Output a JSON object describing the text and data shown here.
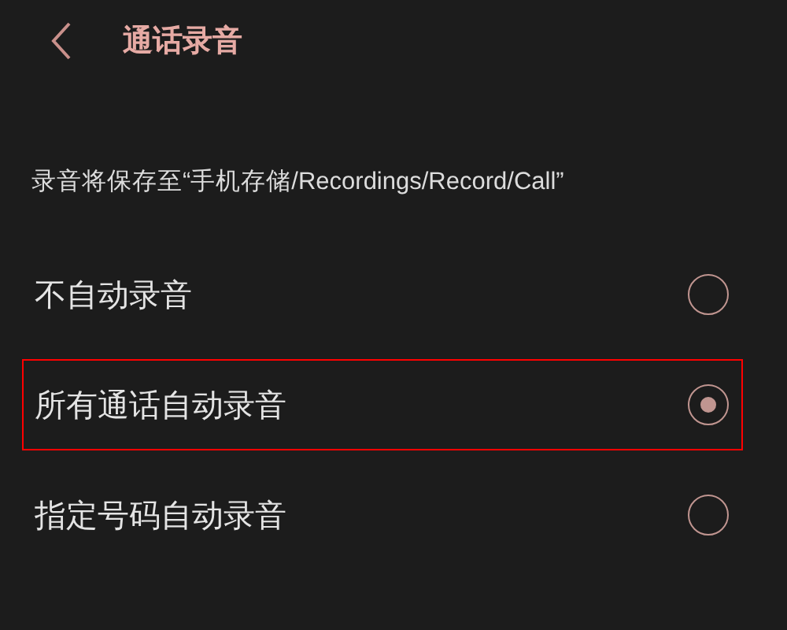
{
  "header": {
    "title": "通话录音"
  },
  "info": "录音将保存至“手机存储/Recordings/Record/Call”",
  "options": [
    {
      "label": "不自动录音",
      "selected": false,
      "highlighted": false
    },
    {
      "label": "所有通话自动录音",
      "selected": true,
      "highlighted": true
    },
    {
      "label": "指定号码自动录音",
      "selected": false,
      "highlighted": false
    }
  ]
}
